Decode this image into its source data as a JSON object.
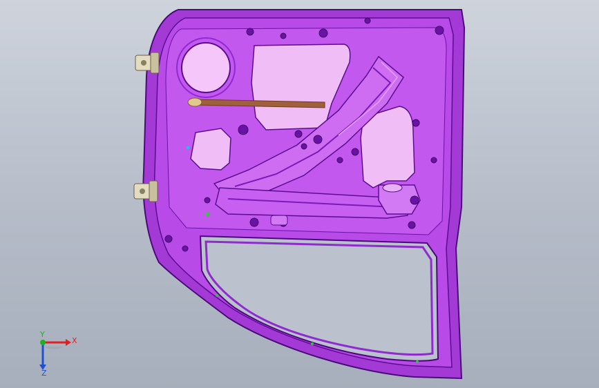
{
  "viewport": {
    "part_color": "#b84ae8",
    "part_dark": "#6a12a8",
    "part_light": "#dba6f5",
    "cutout_color": "#f0bdf7",
    "rod_color": "#a0603c",
    "hinge_color": "#e3dcc0",
    "background_top": "#ced3dc",
    "background_bottom": "#a7afbc"
  },
  "triad": {
    "x_label": "X",
    "y_label": "Y",
    "z_label": "Z",
    "x_color": "#e02020",
    "y_color": "#20b020",
    "z_color": "#2050d0"
  }
}
